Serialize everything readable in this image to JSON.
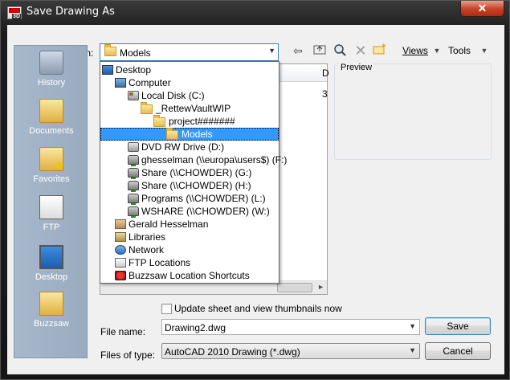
{
  "window": {
    "title": "Save Drawing As",
    "close_label": "✕"
  },
  "toolbar": {
    "save_in_label": "Save in:",
    "save_in_value": "Models",
    "views_label": "Views",
    "tools_label": "Tools"
  },
  "places": [
    {
      "label": "History",
      "icon": "history-icon"
    },
    {
      "label": "Documents",
      "icon": "documents-icon"
    },
    {
      "label": "Favorites",
      "icon": "favorites-icon"
    },
    {
      "label": "FTP",
      "icon": "ftp-icon"
    },
    {
      "label": "Desktop",
      "icon": "desktop-icon"
    },
    {
      "label": "Buzzsaw",
      "icon": "buzzsaw-icon"
    }
  ],
  "file_list": {
    "header_partial": "D",
    "row_partial": "3"
  },
  "preview": {
    "label": "Preview"
  },
  "dropdown": {
    "items": [
      {
        "label": "Desktop",
        "icon": "desktop-icon"
      },
      {
        "label": "Computer",
        "icon": "computer-icon"
      },
      {
        "label": "Local Disk (C:)",
        "icon": "disk-icon"
      },
      {
        "label": "_RettewVaultWIP",
        "icon": "folder-icon"
      },
      {
        "label": "project#######",
        "icon": "folder-icon"
      },
      {
        "label": "Models",
        "icon": "folder-icon",
        "selected": true
      },
      {
        "label": "DVD RW Drive (D:)",
        "icon": "dvd-drive-icon"
      },
      {
        "label": "ghesselman (\\\\europa\\users$) (F:)",
        "icon": "network-drive-icon"
      },
      {
        "label": "Share (\\\\CHOWDER) (G:)",
        "icon": "network-drive-icon"
      },
      {
        "label": "Share (\\\\CHOWDER) (H:)",
        "icon": "network-drive-icon"
      },
      {
        "label": "Programs (\\\\CHOWDER) (L:)",
        "icon": "network-drive-icon"
      },
      {
        "label": "WSHARE (\\\\CHOWDER) (W:)",
        "icon": "network-drive-icon"
      },
      {
        "label": "Gerald Hesselman",
        "icon": "user-folder-icon"
      },
      {
        "label": "Libraries",
        "icon": "libraries-icon"
      },
      {
        "label": "Network",
        "icon": "network-icon"
      },
      {
        "label": "FTP Locations",
        "icon": "ftp-locations-icon"
      },
      {
        "label": "Buzzsaw Location Shortcuts",
        "icon": "buzzsaw-icon"
      }
    ]
  },
  "bottom": {
    "thumbnail_checkbox_label": "Update sheet and view thumbnails now",
    "thumbnail_checked": false,
    "file_name_label": "File name:",
    "file_name_value": "Drawing2.dwg",
    "file_type_label": "Files of type:",
    "file_type_value": "AutoCAD 2010 Drawing (*.dwg)",
    "save_button": "Save",
    "cancel_button": "Cancel"
  }
}
